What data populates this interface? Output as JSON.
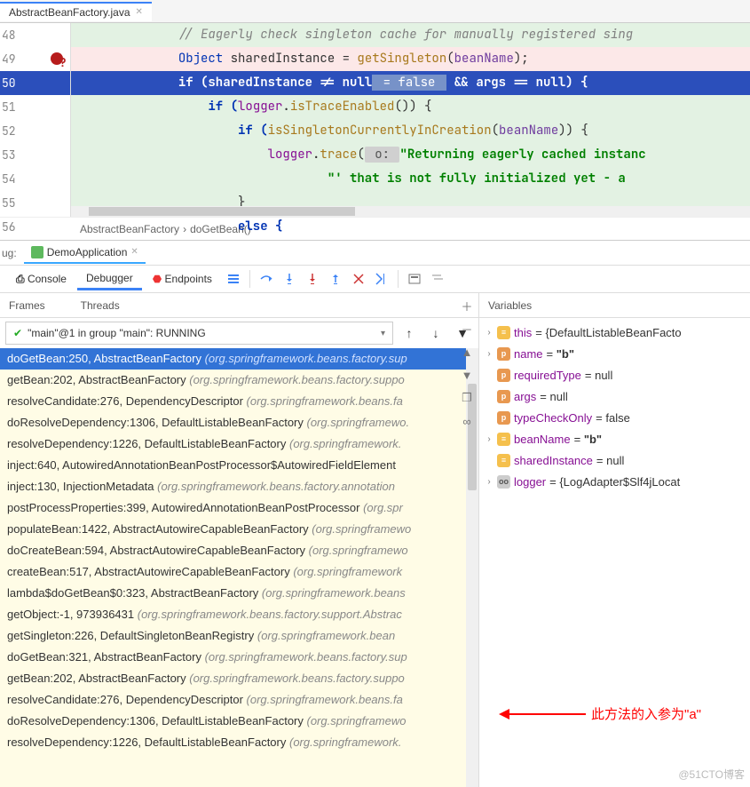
{
  "editor": {
    "tab": "AbstractBeanFactory.java",
    "lines": [
      {
        "num": "48"
      },
      {
        "num": "49"
      },
      {
        "num": "50"
      },
      {
        "num": "51"
      },
      {
        "num": "52"
      },
      {
        "num": "53"
      },
      {
        "num": "54"
      },
      {
        "num": "55"
      },
      {
        "num": "56"
      }
    ],
    "code": {
      "l48_cmt": "// Eagerly check singleton cache for manually registered sing",
      "l49_cls": "Object",
      "l49_var": " sharedInstance = ",
      "l49_mth": "getSingleton",
      "l49_paren_open": "(",
      "l49_prm": "beanName",
      "l49_end": ");",
      "l50_pre": "if (sharedInstance != null",
      "l50_hint": " = false ",
      "l50_post": " && args == null) {",
      "l51_pre": "if (",
      "l51_fld": "logger",
      "l51_dot": ".",
      "l51_mth": "isTraceEnabled",
      "l51_end": "()) {",
      "l52_pre": "if (",
      "l52_mth": "isSingletonCurrentlyInCreation",
      "l52_paren_open": "(",
      "l52_prm": "beanName",
      "l52_end": ")) {",
      "l53_fld": "logger",
      "l53_dot": ".",
      "l53_mth": "trace",
      "l53_paren": "(",
      "l53_hint": " o: ",
      "l53_str": "\"Returning eagerly cached instanc",
      "l54_str": "\"' that is not fully initialized yet - a ",
      "l55": "}",
      "l56": "else {"
    },
    "breadcrumb": {
      "file": "AbstractBeanFactory",
      "sep": "›",
      "method": "doGetBean()"
    }
  },
  "debug": {
    "label": "ug:",
    "run_config": "DemoApplication",
    "tabs": {
      "console": "Console",
      "debugger": "Debugger",
      "endpoints": "Endpoints"
    },
    "panel_headers": {
      "frames": "Frames",
      "threads": "Threads",
      "variables": "Variables"
    },
    "thread_dd": "\"main\"@1 in group \"main\": RUNNING"
  },
  "frames": [
    {
      "m": "doGetBean:250, AbstractBeanFactory ",
      "loc": "(org.springframework.beans.factory.sup",
      "sel": true
    },
    {
      "m": "getBean:202, AbstractBeanFactory ",
      "loc": "(org.springframework.beans.factory.suppo"
    },
    {
      "m": "resolveCandidate:276, DependencyDescriptor ",
      "loc": "(org.springframework.beans.fa"
    },
    {
      "m": "doResolveDependency:1306, DefaultListableBeanFactory ",
      "loc": "(org.springframewo."
    },
    {
      "m": "resolveDependency:1226, DefaultListableBeanFactory ",
      "loc": "(org.springframework."
    },
    {
      "m": "inject:640, AutowiredAnnotationBeanPostProcessor$AutowiredFieldElement",
      "loc": ""
    },
    {
      "m": "inject:130, InjectionMetadata ",
      "loc": "(org.springframework.beans.factory.annotation"
    },
    {
      "m": "postProcessProperties:399, AutowiredAnnotationBeanPostProcessor ",
      "loc": "(org.spr"
    },
    {
      "m": "populateBean:1422, AbstractAutowireCapableBeanFactory ",
      "loc": "(org.springframewo"
    },
    {
      "m": "doCreateBean:594, AbstractAutowireCapableBeanFactory ",
      "loc": "(org.springframewo"
    },
    {
      "m": "createBean:517, AbstractAutowireCapableBeanFactory ",
      "loc": "(org.springframework"
    },
    {
      "m": "lambda$doGetBean$0:323, AbstractBeanFactory ",
      "loc": "(org.springframework.beans"
    },
    {
      "m": "getObject:-1, 973936431 ",
      "loc": "(org.springframework.beans.factory.support.Abstrac"
    },
    {
      "m": "getSingleton:226, DefaultSingletonBeanRegistry ",
      "loc": "(org.springframework.bean"
    },
    {
      "m": "doGetBean:321, AbstractBeanFactory ",
      "loc": "(org.springframework.beans.factory.sup"
    },
    {
      "m": "getBean:202, AbstractBeanFactory ",
      "loc": "(org.springframework.beans.factory.suppo"
    },
    {
      "m": "resolveCandidate:276, DependencyDescriptor ",
      "loc": "(org.springframework.beans.fa"
    },
    {
      "m": "doResolveDependency:1306, DefaultListableBeanFactory ",
      "loc": "(org.springframewo"
    },
    {
      "m": "resolveDependency:1226, DefaultListableBeanFactory ",
      "loc": "(org.springframework."
    }
  ],
  "variables": [
    {
      "chev": "›",
      "icon": "f",
      "name": "this",
      "val": " = {DefaultListableBeanFacto"
    },
    {
      "chev": "›",
      "icon": "p",
      "name": "name",
      "val": " = ",
      "bold": "\"b\""
    },
    {
      "chev": "",
      "icon": "p",
      "name": "requiredType",
      "val": " = null"
    },
    {
      "chev": "",
      "icon": "p",
      "name": "args",
      "val": " = null"
    },
    {
      "chev": "",
      "icon": "p",
      "name": "typeCheckOnly",
      "val": " = false"
    },
    {
      "chev": "›",
      "icon": "f",
      "name": "beanName",
      "val": " = ",
      "bold": "\"b\""
    },
    {
      "chev": "",
      "icon": "f",
      "name": "sharedInstance",
      "val": " = null"
    },
    {
      "chev": "›",
      "icon": "oo",
      "name": "logger",
      "val": " = {LogAdapter$Slf4jLocat"
    }
  ],
  "annotation": {
    "text": "此方法的入参为\"a\""
  },
  "watermark": "@51CTO博客"
}
